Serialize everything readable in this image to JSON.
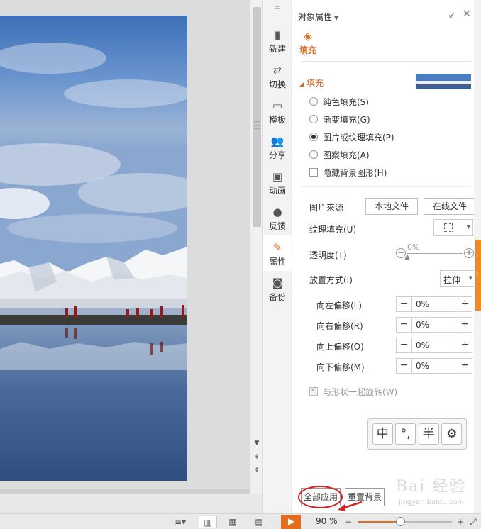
{
  "panel": {
    "title": "对象属性",
    "tab_fill": "填充",
    "section_fill": "填充",
    "fill_options": [
      {
        "label": "纯色填充(S)",
        "checked": false
      },
      {
        "label": "渐变填充(G)",
        "checked": false
      },
      {
        "label": "图片或纹理填充(P)",
        "checked": true
      },
      {
        "label": "图案填充(A)",
        "checked": false
      }
    ],
    "hide_bg_graphics": {
      "label": "隐藏背景图形(H)",
      "checked": false
    },
    "picture_source_label": "图片来源",
    "local_file_btn": "本地文件",
    "online_file_btn": "在线文件",
    "texture_fill_label": "纹理填充(U)",
    "transparency_label": "透明度(T)",
    "transparency_value": "0%",
    "transparency_fraction": 0,
    "placement_label": "放置方式(I)",
    "placement_value": "拉伸",
    "offsets": [
      {
        "label": "向左偏移(L)",
        "value": "0%"
      },
      {
        "label": "向右偏移(R)",
        "value": "0%"
      },
      {
        "label": "向上偏移(O)",
        "value": "0%"
      },
      {
        "label": "向下偏移(M)",
        "value": "0%"
      }
    ],
    "rotate_with_shape": {
      "label": "与形状一起旋转(W)",
      "checked": true
    },
    "ime_keys": [
      "中",
      "°,",
      "半",
      "⚙"
    ],
    "apply_all_btn": "全部应用",
    "reset_bg_btn": "重置背景",
    "watermark": "Bai 经验",
    "watermark_sub": "jingyan.baidu.com"
  },
  "sidebar": {
    "items": [
      {
        "label": "新建",
        "icon": "new-doc-icon"
      },
      {
        "label": "切换",
        "icon": "switch-icon"
      },
      {
        "label": "模板",
        "icon": "template-icon"
      },
      {
        "label": "分享",
        "icon": "share-icon"
      },
      {
        "label": "动画",
        "icon": "animation-icon"
      },
      {
        "label": "反馈",
        "icon": "feedback-icon"
      },
      {
        "label": "属性",
        "icon": "properties-icon",
        "active": true
      },
      {
        "label": "备份",
        "icon": "backup-icon"
      }
    ]
  },
  "status": {
    "zoom": "90 %",
    "zoom_fraction": 0.45
  },
  "colors": {
    "accent": "#d76a23",
    "play": "#e36c1e",
    "annotation": "#d32222"
  }
}
